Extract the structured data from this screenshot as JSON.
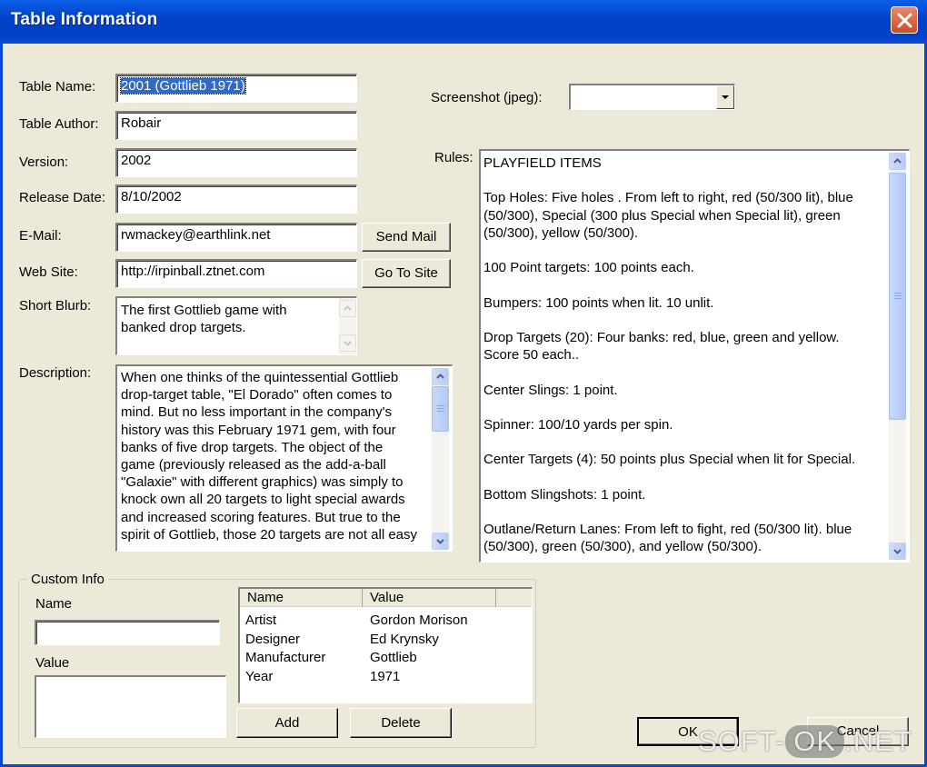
{
  "window": {
    "title": "Table Information"
  },
  "fields": {
    "table_name": {
      "label": "Table Name:",
      "value": "2001 (Gottlieb 1971)"
    },
    "table_author": {
      "label": "Table Author:",
      "value": "Robair"
    },
    "version": {
      "label": "Version:",
      "value": "2002"
    },
    "release_date": {
      "label": "Release Date:",
      "value": "8/10/2002"
    },
    "email": {
      "label": "E-Mail:",
      "value": "rwmackey@earthlink.net",
      "button": "Send Mail"
    },
    "website": {
      "label": "Web Site:",
      "value": "http://irpinball.ztnet.com",
      "button": "Go To Site"
    },
    "short_blurb": {
      "label": "Short Blurb:",
      "lines": [
        "The first Gottlieb game with",
        "banked drop targets."
      ]
    },
    "description": {
      "label": "Description:",
      "lines": [
        "When one thinks of the quintessential Gottlieb",
        "drop-target table, \"El Dorado\" often comes to",
        "mind. But no less important in the company's",
        "history was this February 1971 gem, with four",
        "banks of five drop targets. The object of the",
        "game (previously released as the add-a-ball",
        "\"Galaxie\" with different graphics) was simply to",
        "knock own all 20 targets to light special awards",
        "and increased scoring features. But true to the",
        "spirit of Gottlieb, those 20 targets are not all easy"
      ]
    }
  },
  "screenshot": {
    "label": "Screenshot (jpeg):",
    "value": ""
  },
  "rules": {
    "label": "Rules:",
    "lines": [
      "PLAYFIELD ITEMS",
      "",
      "Top Holes: Five holes . From left to right, red (50/300 lit), blue",
      "(50/300), Special (300 plus Special when Special lit), green",
      "(50/300), yellow (50/300).",
      "",
      "100 Point targets: 100 points each.",
      "",
      "Bumpers: 100 points when lit. 10 unlit.",
      "",
      "Drop Targets (20): Four banks: red, blue, green and yellow.",
      "Score 50 each..",
      "",
      "Center Slings: 1 point.",
      "",
      "Spinner: 100/10 yards per spin.",
      "",
      "Center Targets (4): 50 points plus Special when lit for Special.",
      "",
      "Bottom Slingshots: 1 point.",
      "",
      "Outlane/Return Lanes: From left to fight, red (50/300 lit). blue",
      "(50/300), green (50/300), and yellow (50/300)."
    ]
  },
  "custom_info": {
    "legend": "Custom Info",
    "name_label": "Name",
    "value_label": "Value",
    "columns": [
      "Name",
      "Value"
    ],
    "rows": [
      {
        "name": "Artist",
        "value": "Gordon Morison"
      },
      {
        "name": "Designer",
        "value": "Ed Krynsky"
      },
      {
        "name": "Manufacturer",
        "value": "Gottlieb"
      },
      {
        "name": "Year",
        "value": "1971"
      }
    ],
    "add_button": "Add",
    "delete_button": "Delete"
  },
  "buttons": {
    "ok": "OK",
    "cancel": "Cancel"
  },
  "watermark": {
    "left": "SOFT-",
    "ok": "OK",
    "right": ".NET"
  }
}
